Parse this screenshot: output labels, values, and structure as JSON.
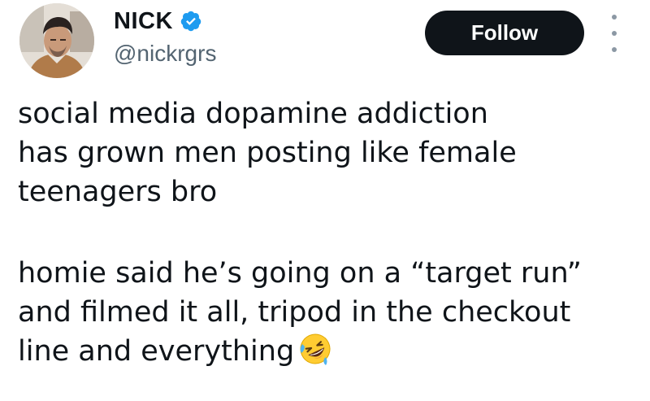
{
  "author": {
    "display_name": "NICK",
    "handle": "@nickrgrs",
    "verified": true,
    "verified_color": "#1d9bf0",
    "avatar_icon": "profile-photo"
  },
  "actions": {
    "follow_label": "Follow",
    "more_icon": "more-vertical-icon"
  },
  "tweet": {
    "paragraph_1": "social media dopamine addiction\nhas grown men posting like female\nteenagers bro",
    "paragraph_2": "homie said he’s going on a “target run”\nand filmed it all, tripod in the checkout\nline and everything",
    "emoji": "rolling-on-the-floor-laughing-emoji"
  },
  "colors": {
    "text": "#0f1419",
    "secondary_text": "#536471",
    "button_bg": "#0f1419",
    "button_text": "#ffffff"
  }
}
